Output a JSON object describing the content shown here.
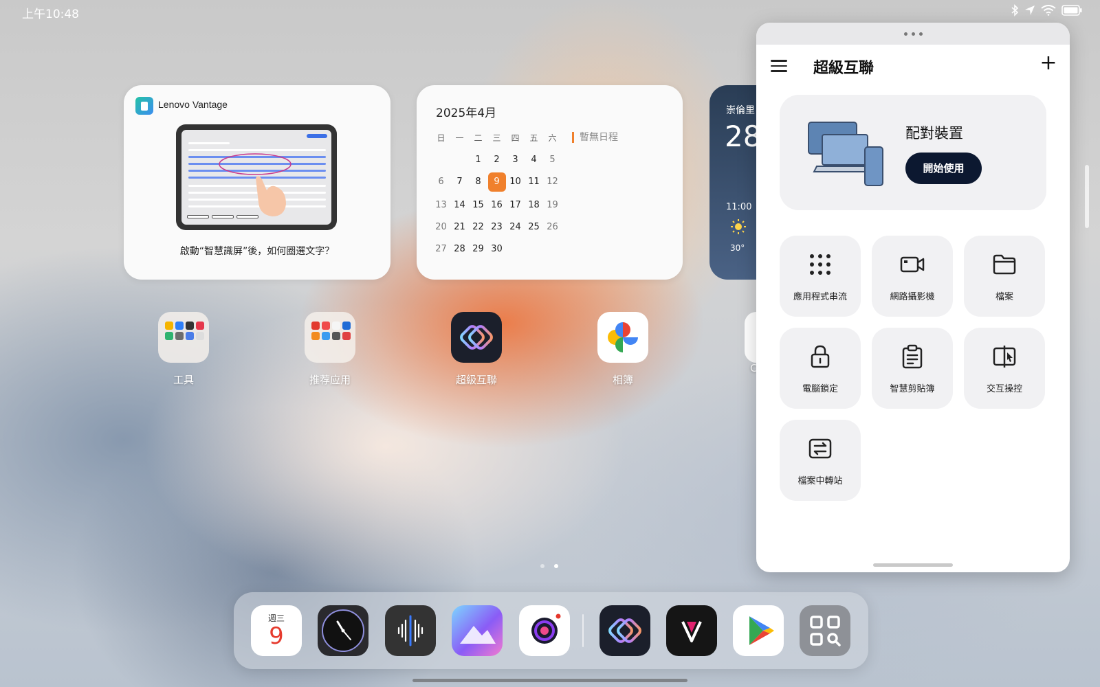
{
  "status_bar": {
    "time": "上午10:48"
  },
  "widgets": {
    "vantage": {
      "app_name": "Lenovo Vantage",
      "caption": "啟動“智慧識屏”後，如何圈選文字？"
    },
    "calendar": {
      "title": "2025年4月",
      "weekdays": [
        "日",
        "一",
        "二",
        "三",
        "四",
        "五",
        "六"
      ],
      "no_events": "暫無日程",
      "today": "9",
      "weeks": [
        [
          "",
          "",
          "1",
          "2",
          "3",
          "4",
          "5"
        ],
        [
          "6",
          "7",
          "8",
          "9",
          "10",
          "11",
          "12"
        ],
        [
          "13",
          "14",
          "15",
          "16",
          "17",
          "18",
          "19"
        ],
        [
          "20",
          "21",
          "22",
          "23",
          "24",
          "25",
          "26"
        ],
        [
          "27",
          "28",
          "29",
          "30",
          "",
          "",
          ""
        ]
      ]
    },
    "weather": {
      "city": "崇倫里",
      "temp": "28",
      "hour": "11:00",
      "hour_temp": "30°"
    }
  },
  "home_apps": [
    {
      "label": "工具",
      "icon": "tools-folder-icon"
    },
    {
      "label": "推荐应用",
      "icon": "recommended-folder-icon"
    },
    {
      "label": "超級互聯",
      "icon": "super-connect-icon"
    },
    {
      "label": "相簿",
      "icon": "google-photos-icon"
    }
  ],
  "home_partial_label": "C",
  "dock": {
    "calendar_weekday": "週三",
    "calendar_day": "9",
    "apps": [
      "calendar-icon",
      "clock-icon",
      "voice-recorder-icon",
      "gallery-icon",
      "camera-icon",
      "super-connect-icon",
      "vantage-icon",
      "play-store-icon",
      "app-library-icon"
    ]
  },
  "window": {
    "title": "超級互聯",
    "pair": {
      "title": "配對裝置",
      "button": "開始使用"
    },
    "features": [
      {
        "label": "應用程式串流",
        "icon": "grid-dots-icon"
      },
      {
        "label": "網路攝影機",
        "icon": "video-camera-icon"
      },
      {
        "label": "檔案",
        "icon": "folder-icon"
      },
      {
        "label": "電腦鎖定",
        "icon": "lock-icon"
      },
      {
        "label": "智慧剪貼簿",
        "icon": "clipboard-icon"
      },
      {
        "label": "交互操控",
        "icon": "mirror-cursor-icon"
      },
      {
        "label": "檔案中轉站",
        "icon": "transfer-icon"
      }
    ]
  },
  "colors": {
    "accent_orange": "#f0802c",
    "pair_button": "#0c1830"
  }
}
